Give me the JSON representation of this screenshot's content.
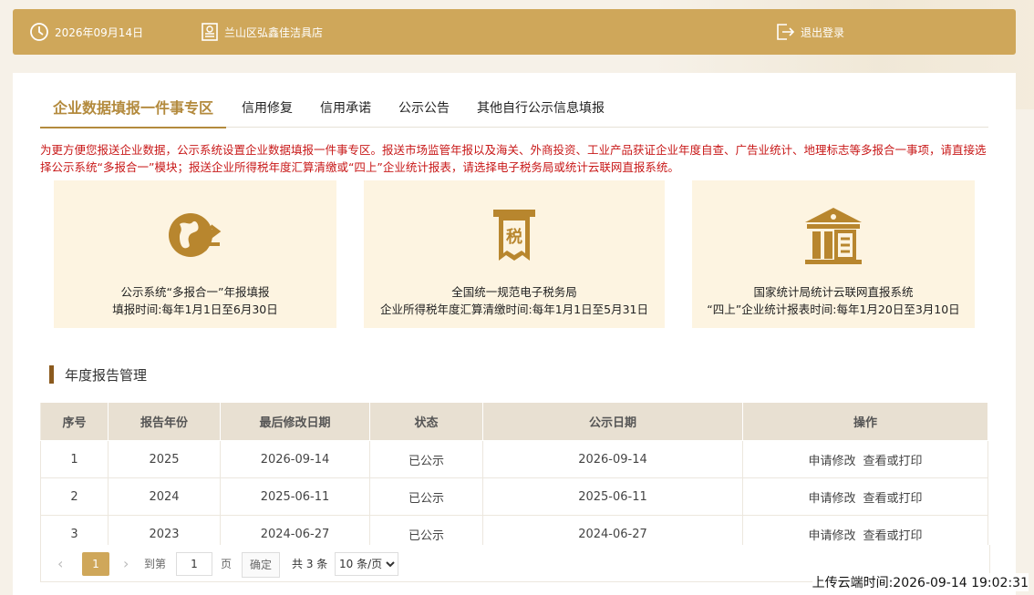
{
  "header": {
    "date": "2026年09月14日",
    "store": "兰山区弘鑫佳洁具店",
    "logout": "退出登录"
  },
  "tabs": [
    {
      "label": "企业数据填报一件事专区"
    },
    {
      "label": "信用修复"
    },
    {
      "label": "信用承诺"
    },
    {
      "label": "公示公告"
    },
    {
      "label": "其他自行公示信息填报"
    }
  ],
  "notice": "为更方便您报送企业数据，公示系统设置企业数据填报一件事专区。报送市场监管年报以及海关、外商投资、工业产品获证企业年度自查、广告业统计、地理标志等多报合一事项，请直接选择公示系统“多报合一”模块；报送企业所得税年度汇算清缴或“四上”企业统计报表，请选择电子税务局或统计云联网直报系统。",
  "cards": [
    {
      "icon": "globe-arrows-icon",
      "line1": "公示系统“多报合一”年报填报",
      "line2": "填报时间:每年1月1日至6月30日"
    },
    {
      "icon": "tax-receipt-icon",
      "line1": "全国统一规范电子税务局",
      "line2": "企业所得税年度汇算清缴时间:每年1月1日至5月31日"
    },
    {
      "icon": "government-building-icon",
      "line1": "国家统计局统计云联网直报系统",
      "line2": "“四上”企业统计报表时间:每年1月20日至3月10日"
    }
  ],
  "section_title": "年度报告管理",
  "table": {
    "headers": [
      "序号",
      "报告年份",
      "最后修改日期",
      "状态",
      "公示日期",
      "操作"
    ],
    "rows": [
      {
        "no": "1",
        "year": "2025",
        "modified": "2026-09-14",
        "status": "已公示",
        "published": "2026-09-14",
        "op1": "申请修改",
        "op2": "查看或打印"
      },
      {
        "no": "2",
        "year": "2024",
        "modified": "2025-06-11",
        "status": "已公示",
        "published": "2025-06-11",
        "op1": "申请修改",
        "op2": "查看或打印"
      },
      {
        "no": "3",
        "year": "2023",
        "modified": "2024-06-27",
        "status": "已公示",
        "published": "2024-06-27",
        "op1": "申请修改",
        "op2": "查看或打印"
      }
    ]
  },
  "pager": {
    "current": "1",
    "goto_label": "到第",
    "goto_value": "1",
    "page_label": "页",
    "confirm": "确定",
    "total": "共 3 条",
    "page_size": "10 条/页"
  },
  "footer": {
    "upload_time": "上传云端时间:2026-09-14 19:02:31"
  },
  "colors": {
    "accent": "#cfa75a",
    "active_tab": "#b38a3d",
    "notice": "#c81818",
    "card_bg": "#fdf4e1"
  }
}
